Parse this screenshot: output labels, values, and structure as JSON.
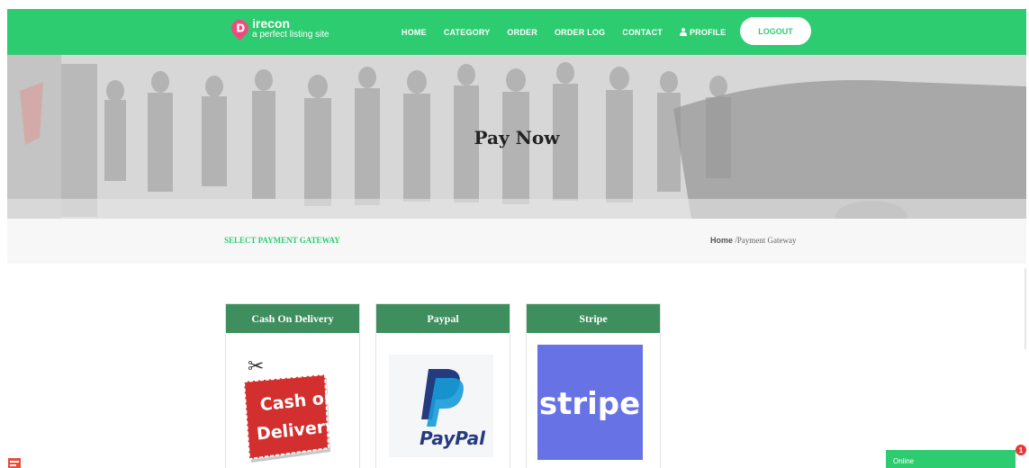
{
  "brand": {
    "letter": "D",
    "name": "irecon",
    "tagline": "a perfect listing site",
    "color": "#2ecc71"
  },
  "nav": {
    "items": [
      {
        "label": "HOME"
      },
      {
        "label": "CATEGORY"
      },
      {
        "label": "ORDER"
      },
      {
        "label": "ORDER LOG"
      },
      {
        "label": "CONTACT"
      },
      {
        "label": "PROFILE",
        "icon": "user-icon"
      }
    ],
    "logout_label": "LOGOUT"
  },
  "hero": {
    "title": "Pay Now"
  },
  "breadcrumb": {
    "section_title": "SELECT PAYMENT GATEWAY",
    "home": "Home",
    "separator": " /",
    "current": "Payment Gateway"
  },
  "gateways": [
    {
      "name": "Cash On Delivery",
      "logo_text_1": "Cash on",
      "logo_text_2": "Delivery"
    },
    {
      "name": "Paypal",
      "logo_text": "PayPal"
    },
    {
      "name": "Stripe",
      "logo_text": "stripe"
    }
  ],
  "chat": {
    "status": "Online",
    "unread": "1"
  }
}
